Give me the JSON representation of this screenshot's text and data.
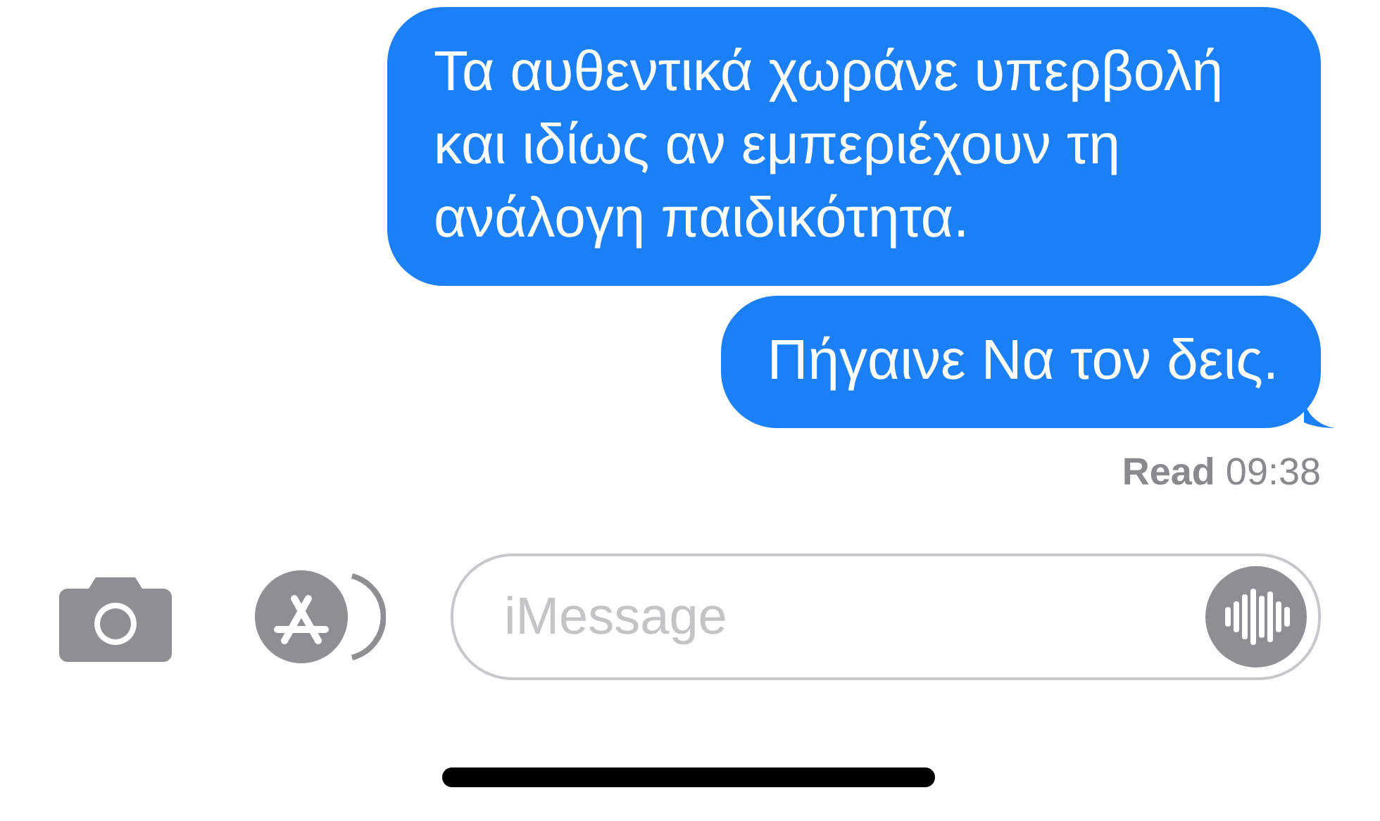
{
  "messages": [
    {
      "text": "Τα αυθεντικά χωράνε υπερβολή και ιδίως αν εμπεριέχουν τη ανάλογη παιδικότητα.",
      "tail": false
    },
    {
      "text": "Πήγαινε Να τον δεις.",
      "tail": true
    }
  ],
  "receipt": {
    "label": "Read",
    "time": "09:38"
  },
  "composer": {
    "placeholder": "iMessage"
  }
}
